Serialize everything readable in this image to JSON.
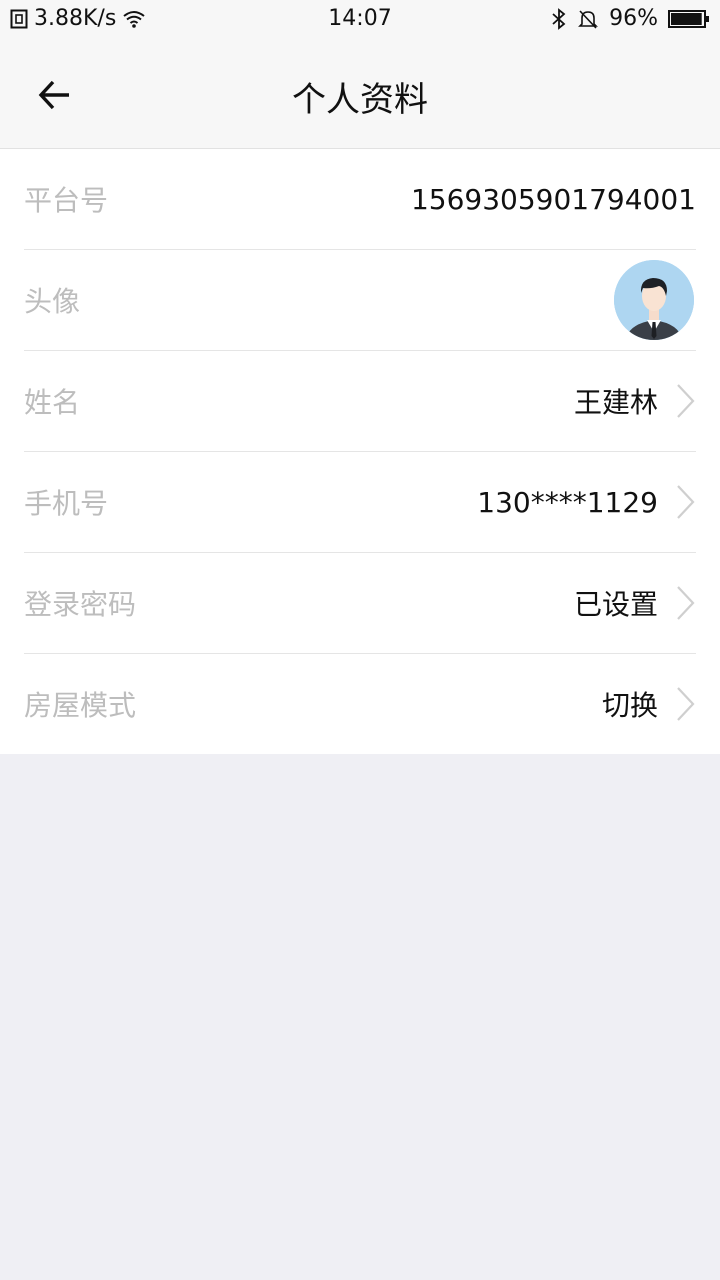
{
  "statusbar": {
    "network_speed": "3.88K/s",
    "time": "14:07",
    "battery": "96%",
    "battery_level": 0.96
  },
  "header": {
    "title": "个人资料",
    "back_icon": "back-arrow-icon"
  },
  "profile": {
    "platform_id": {
      "label": "平台号",
      "value": "1569305901794001"
    },
    "avatar": {
      "label": "头像",
      "icon": "user-avatar-icon"
    },
    "name": {
      "label": "姓名",
      "value": "王建林"
    },
    "phone": {
      "label": "手机号",
      "value": "130****1129"
    },
    "password": {
      "label": "登录密码",
      "value": "已设置"
    },
    "house_mode": {
      "label": "房屋模式",
      "value": "切换"
    }
  },
  "colors": {
    "header_bg": "#f7f7f7",
    "page_bg": "#efeff4",
    "label": "#bdbdbd",
    "value": "#111111",
    "divider": "#e5e5e5",
    "avatar_bg": "#aed6f1"
  }
}
